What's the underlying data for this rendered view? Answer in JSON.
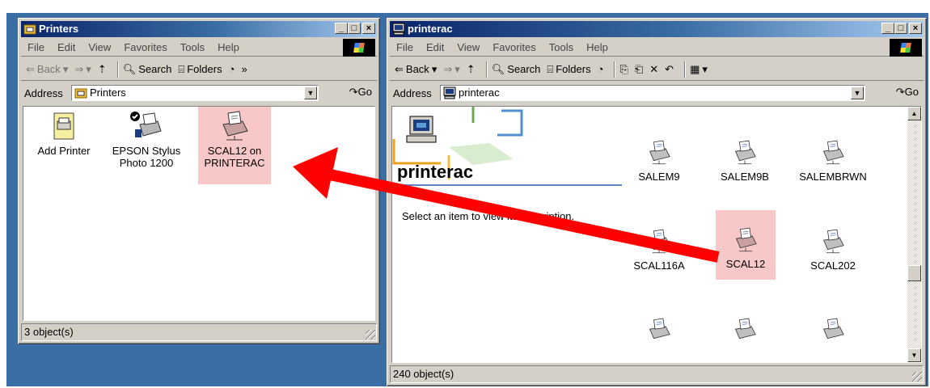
{
  "left_window": {
    "title": "Printers",
    "menu": [
      "File",
      "Edit",
      "View",
      "Favorites",
      "Tools",
      "Help"
    ],
    "toolbar": {
      "back": "Back",
      "search": "Search",
      "folders": "Folders",
      "more": "»"
    },
    "address_label": "Address",
    "address_value": "Printers",
    "go_label": "Go",
    "items": [
      {
        "label": "Add Printer"
      },
      {
        "label": "EPSON Stylus Photo 1200"
      },
      {
        "label": "SCAL12 on PRINTERAC"
      }
    ],
    "status": "3 object(s)"
  },
  "right_window": {
    "title": "printerac",
    "menu": [
      "File",
      "Edit",
      "View",
      "Favorites",
      "Tools",
      "Help"
    ],
    "toolbar": {
      "back": "Back",
      "search": "Search",
      "folders": "Folders"
    },
    "address_label": "Address",
    "address_value": "printerac",
    "go_label": "Go",
    "folder_heading": "printerac",
    "folder_description": "Select an item to view its description.",
    "items": [
      {
        "label": "SALEM9"
      },
      {
        "label": "SALEM9B"
      },
      {
        "label": "SALEMBRWN"
      },
      {
        "label": "SCAL116A"
      },
      {
        "label": "SCAL12"
      },
      {
        "label": "SCAL202"
      },
      {
        "label": ""
      },
      {
        "label": ""
      },
      {
        "label": ""
      }
    ],
    "status": "240 object(s)"
  },
  "colors": {
    "desktop": "#3a6ea5",
    "title_active": "#0a246a",
    "selection_highlight": "#f8c8c8",
    "arrow": "#ff0000"
  }
}
